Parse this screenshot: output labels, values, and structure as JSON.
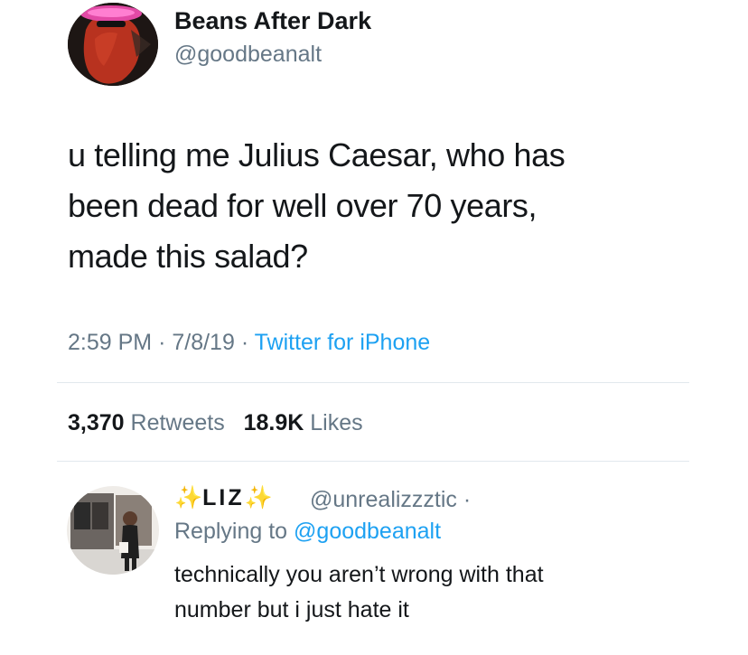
{
  "tweet": {
    "author_name": "Beans After Dark",
    "author_handle": "@goodbeanalt",
    "text_line1": "u telling me Julius Caesar, who has",
    "text_line2": "been dead for well over 70 years,",
    "text_line3": "made this salad?",
    "time": "2:59 PM",
    "date": "7/8/19",
    "source": "Twitter for iPhone",
    "separator": "·",
    "retweets_count": "3,370",
    "retweets_label": "Retweets",
    "likes_count": "18.9K",
    "likes_label": "Likes",
    "avatar_icon": "bean-character-avatar"
  },
  "reply": {
    "name_sparkle_left": "✨",
    "name_text": "LIZ",
    "name_sparkle_right": "✨",
    "handle": "@unrealizzztic",
    "handle_suffix": "·",
    "replying_prefix": "Replying to",
    "replying_to": "@goodbeanalt",
    "text_line1": "technically you aren’t wrong with that",
    "text_line2": "number but i just hate it",
    "avatar_icon": "person-photo-avatar"
  },
  "colors": {
    "text": "#14171a",
    "secondary": "#657786",
    "link": "#1da1f2",
    "divider": "#e1e8ed"
  }
}
